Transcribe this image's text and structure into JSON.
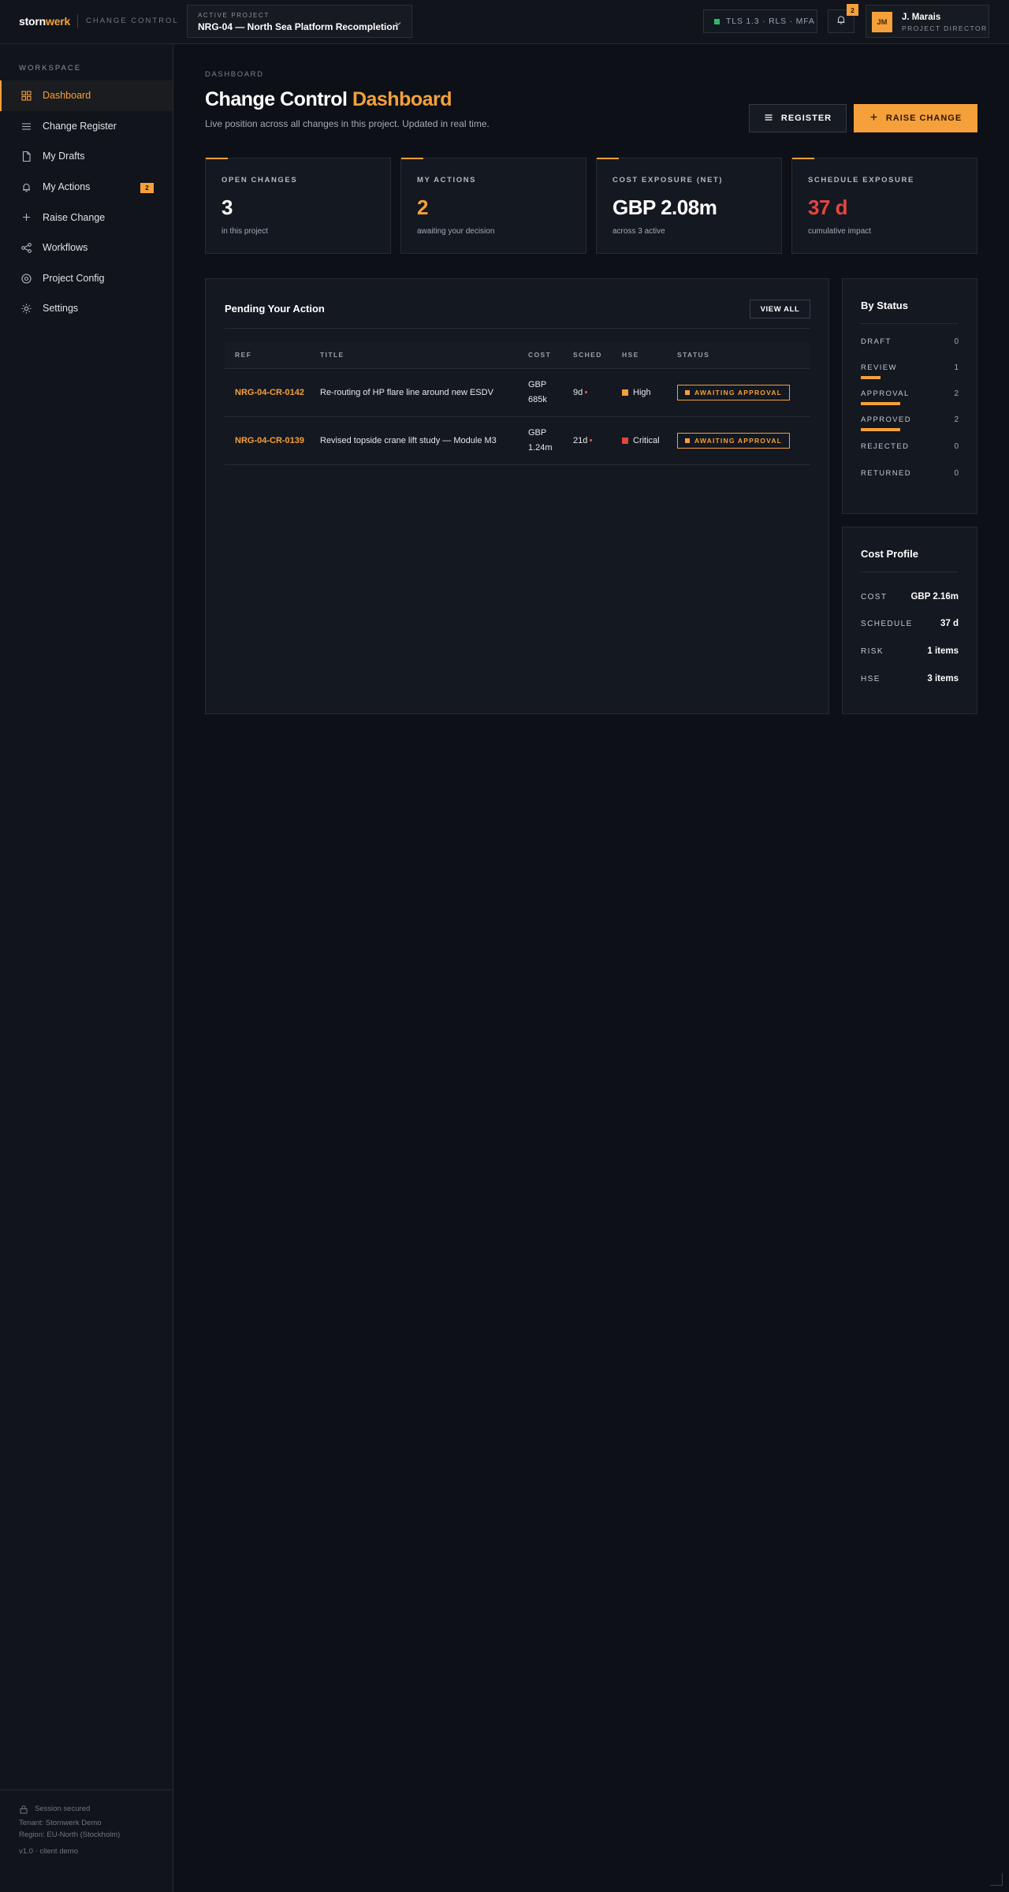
{
  "header": {
    "brand_main": "storn",
    "brand_accent": "werk",
    "brand_sub": "CHANGE CONTROL",
    "project_label": "ACTIVE PROJECT",
    "project_value": "NRG-04 — North Sea Platform Recompletion",
    "security": "TLS 1.3 · RLS · MFA",
    "notifications": "2",
    "user_initials": "JM",
    "user_name": "J. Marais",
    "user_role": "PROJECT DIRECTOR"
  },
  "sidebar": {
    "section_label": "WORKSPACE",
    "items": [
      {
        "label": "Dashboard",
        "icon": "grid-icon"
      },
      {
        "label": "Change Register",
        "icon": "list-icon"
      },
      {
        "label": "My Drafts",
        "icon": "file-icon"
      },
      {
        "label": "My Actions",
        "icon": "bell-icon",
        "count": "2"
      },
      {
        "label": "Raise Change",
        "icon": "plus-icon"
      },
      {
        "label": "Workflows",
        "icon": "workflow-icon"
      },
      {
        "label": "Project Config",
        "icon": "target-icon"
      },
      {
        "label": "Settings",
        "icon": "gear-icon"
      }
    ],
    "footer": {
      "secured": "Session secured",
      "tenant": "Tenant: Stornwerk Demo",
      "region": "Region: EU-North (Stockholm)",
      "version": "v1.0 · client demo"
    }
  },
  "main": {
    "breadcrumb": "DASHBOARD",
    "title_part1": "Change Control ",
    "title_part2": "Dashboard",
    "subtitle": "Live position across all changes in this project. Updated in real time.",
    "register_label": "REGISTER",
    "raise_label": "RAISE CHANGE"
  },
  "kpis": [
    {
      "label": "OPEN CHANGES",
      "value": "3",
      "sub": "in this project"
    },
    {
      "label": "MY ACTIONS",
      "value": "2",
      "sub": "awaiting your decision"
    },
    {
      "label": "COST EXPOSURE (NET)",
      "value": "GBP 2.08m",
      "sub": "across 3 active"
    },
    {
      "label": "SCHEDULE EXPOSURE",
      "value": "37 d",
      "sub": "cumulative impact"
    }
  ],
  "pending": {
    "title": "Pending Your Action",
    "view_all": "VIEW ALL",
    "columns": [
      "REF",
      "TITLE",
      "COST",
      "SCHED",
      "HSE",
      "STATUS"
    ],
    "rows": [
      {
        "ref": "NRG-04-CR-0142",
        "title": "Re-routing of HP flare line around new ESDV",
        "cost_line1": "GBP",
        "cost_line2": "685k",
        "sched": "9d",
        "hse": "High",
        "status": "AWAITING APPROVAL"
      },
      {
        "ref": "NRG-04-CR-0139",
        "title": "Revised topside crane lift study — Module M3",
        "cost_line1": "GBP",
        "cost_line2": "1.24m",
        "sched": "21d",
        "hse": "Critical",
        "status": "AWAITING APPROVAL"
      }
    ]
  },
  "by_status": {
    "title": "By Status",
    "rows": [
      {
        "label": "DRAFT",
        "value": "0"
      },
      {
        "label": "REVIEW",
        "value": "1"
      },
      {
        "label": "APPROVAL",
        "value": "2"
      },
      {
        "label": "APPROVED",
        "value": "2"
      },
      {
        "label": "REJECTED",
        "value": "0"
      },
      {
        "label": "RETURNED",
        "value": "0"
      }
    ]
  },
  "cost_profile": {
    "title": "Cost Profile",
    "rows": [
      {
        "label": "COST",
        "value": "GBP 2.16m"
      },
      {
        "label": "SCHEDULE",
        "value": "37 d"
      },
      {
        "label": "RISK",
        "value": "1 items"
      },
      {
        "label": "HSE",
        "value": "3 items"
      }
    ]
  },
  "colors": {
    "accent": "#f5a03a",
    "danger": "#e5453f",
    "ok": "#2fb96b",
    "hse_high": "#f5a03a",
    "hse_critical": "#e5453f"
  }
}
